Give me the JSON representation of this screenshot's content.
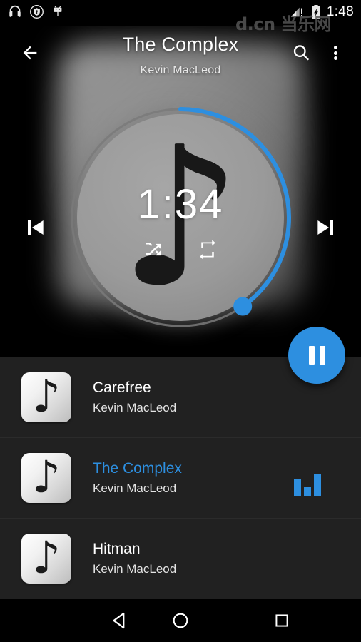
{
  "status_bar": {
    "time": "1:48",
    "left_icons": [
      "headphones-icon",
      "shield-icon",
      "android-icon"
    ],
    "right_icons": [
      "signal-warning-icon",
      "battery-charging-icon"
    ]
  },
  "toolbar": {
    "back_icon": "back-arrow-icon",
    "title": "The Complex",
    "artist": "Kevin MacLeod",
    "search_icon": "search-icon",
    "overflow_icon": "overflow-menu-icon"
  },
  "player": {
    "elapsed_time": "1:34",
    "progress_percent": 40,
    "progress_angle_deg": 145,
    "album_art_icon": "music-note-icon",
    "shuffle_icon": "shuffle-icon",
    "repeat_icon": "repeat-icon",
    "prev_icon": "skip-previous-icon",
    "next_icon": "skip-next-icon",
    "fab_icon": "pause-icon",
    "fab_color": "#2d8fe0",
    "progress_color": "#2d8fe0",
    "track_color": "#7a7a7a",
    "art_color": "#9a9a9a"
  },
  "playlist": {
    "tracks": [
      {
        "title": "Carefree",
        "artist": "Kevin MacLeod",
        "playing": false,
        "thumb_icon": "music-note-icon"
      },
      {
        "title": "The Complex",
        "artist": "Kevin MacLeod",
        "playing": true,
        "thumb_icon": "music-note-icon"
      },
      {
        "title": "Hitman",
        "artist": "Kevin MacLeod",
        "playing": false,
        "thumb_icon": "music-note-icon"
      }
    ],
    "equalizer_bar_heights": [
      24,
      13,
      32
    ],
    "playing_color": "#2d8fe0"
  },
  "nav_bar": {
    "back_icon": "nav-back-triangle-icon",
    "home_icon": "nav-home-circle-icon",
    "recents_icon": "nav-recents-square-icon"
  },
  "watermark": {
    "text": "d.cn 当乐网"
  }
}
